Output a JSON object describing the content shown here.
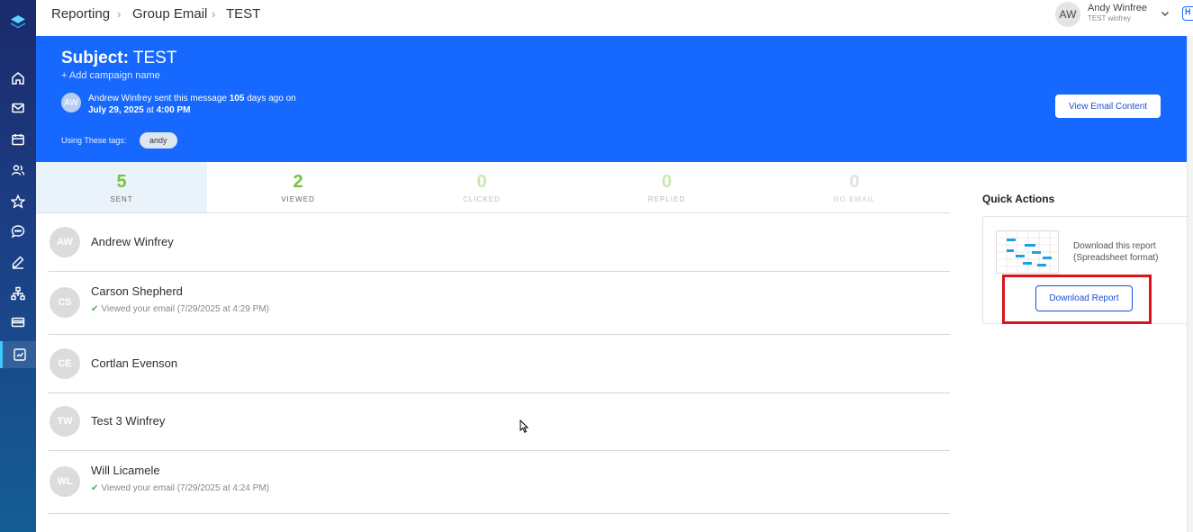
{
  "breadcrumb": [
    "Reporting",
    "Group Email",
    "TEST"
  ],
  "user": {
    "initials": "AW",
    "name": "Andy Winfree",
    "sub": "TEST winfrey",
    "help_label": "H"
  },
  "banner": {
    "subject_label": "Subject:",
    "subject_value": "TEST",
    "add_campaign": "+ Add campaign name",
    "sender_initials": "AW",
    "sender_text_pre": "Andrew Winfrey sent this message ",
    "sender_days": "105",
    "sender_text_post": " days ago on",
    "sent_date": "July 29, 2025",
    "sent_at": " at ",
    "sent_time": "4:00 PM",
    "tags_label": "Using These tags:",
    "tag": "andy",
    "view_button": "View Email Content"
  },
  "stats": [
    {
      "value": "5",
      "label": "SENT",
      "color": "#7bc043"
    },
    {
      "value": "2",
      "label": "VIEWED",
      "color": "#7bc043"
    },
    {
      "value": "0",
      "label": "CLICKED",
      "color": "#c9e6b3"
    },
    {
      "value": "0",
      "label": "REPLIED",
      "color": "#c9e6b3"
    },
    {
      "value": "0",
      "label": "NO EMAIL",
      "color": "#e2e2e2"
    }
  ],
  "recipients": [
    {
      "initials": "AW",
      "name": "Andrew Winfrey",
      "viewed": ""
    },
    {
      "initials": "CS",
      "name": "Carson Shepherd",
      "viewed": "Viewed your email (7/29/2025 at 4:29 PM)"
    },
    {
      "initials": "CE",
      "name": "Cortlan Evenson",
      "viewed": ""
    },
    {
      "initials": "TW",
      "name": "Test 3 Winfrey",
      "viewed": ""
    },
    {
      "initials": "WL",
      "name": "Will Licamele",
      "viewed": "Viewed your email (7/29/2025 at 4:24 PM)"
    }
  ],
  "quick_actions": {
    "title": "Quick Actions",
    "line1": "Download this report",
    "line2": "(Spreadsheet format)",
    "button": "Download Report"
  },
  "colors": {
    "banner": "#1668ff",
    "accent": "#1e4fd8",
    "highlight": "#e0111b"
  }
}
